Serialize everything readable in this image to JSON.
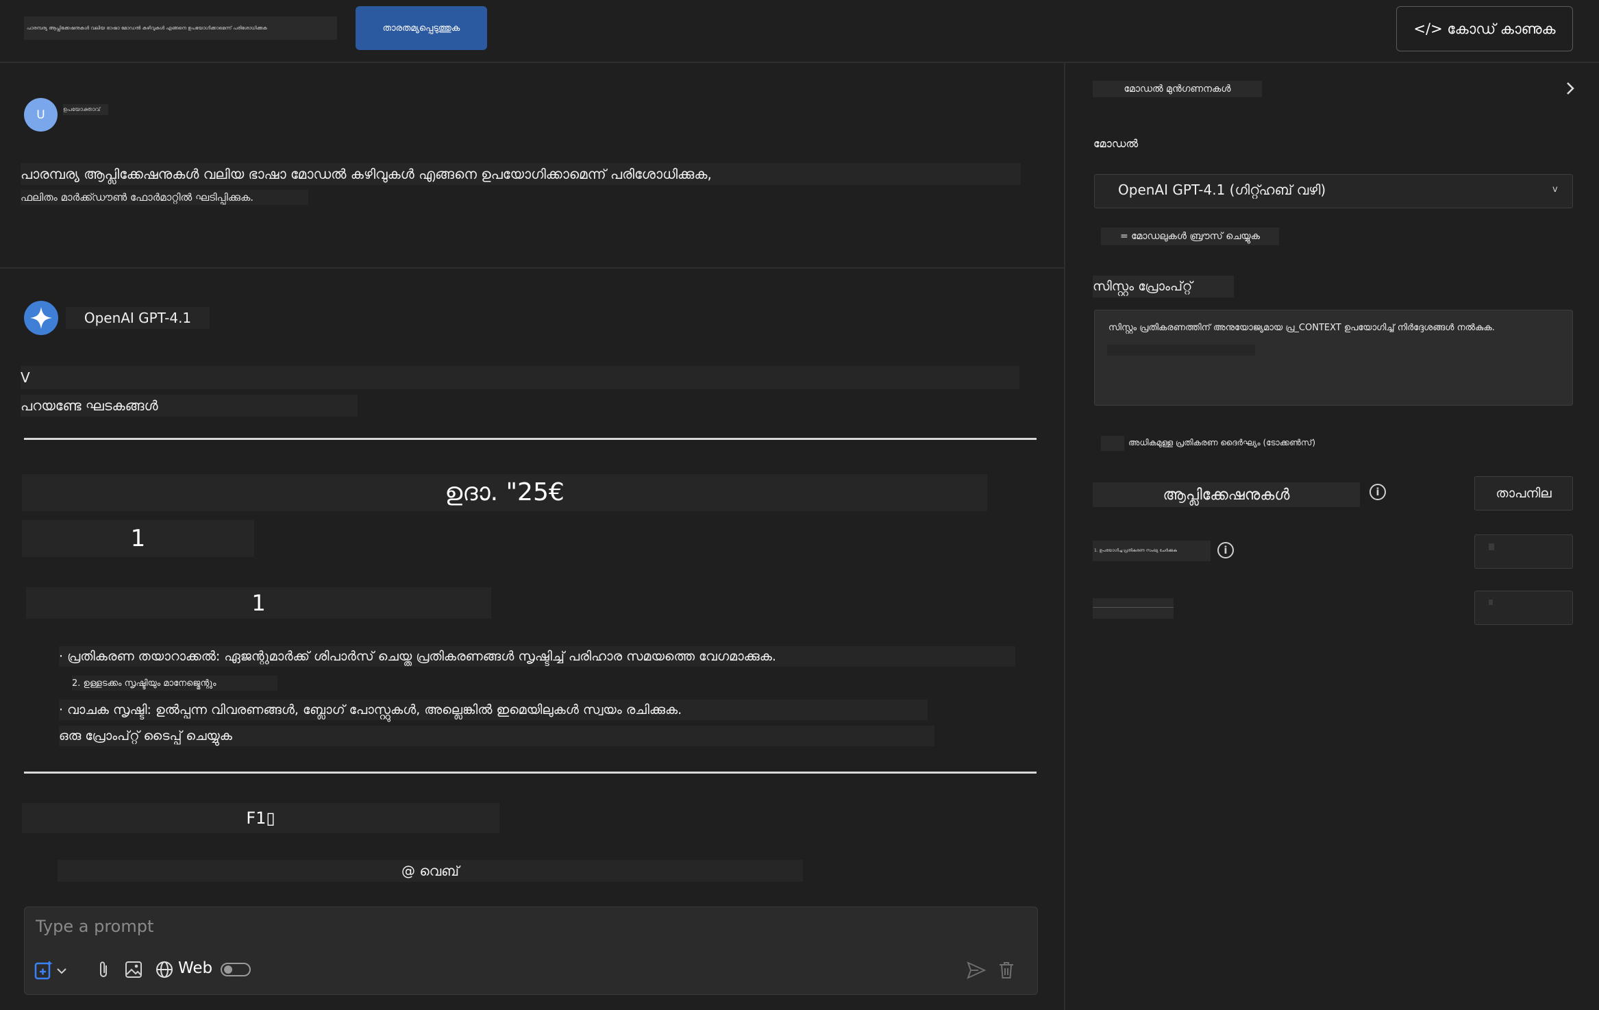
{
  "header": {
    "prompt_text": "പാരമ്പര്യ ആപ്ലിക്കേഷനുകൾ വലിയ ഭാഷാ മോഡൽ കഴിവുകൾ എങ്ങനെ ഉപയോഗിക്കാമെന്ന് പരിശോധിക്കുക",
    "compare_button": "താരതമ്യപ്പെടുത്തുക",
    "view_code_button": "</> കോഡ് കാണുക"
  },
  "user_message": {
    "avatar_letter": "U",
    "role": "ഉപയോക്താവ്",
    "line1": "പാരമ്പര്യ ആപ്ലിക്കേഷനുകൾ വലിയ ഭാഷാ മോഡൽ കഴിവുകൾ എങ്ങനെ ഉപയോഗിക്കാമെന്ന് പരിശോധിക്കുക,",
    "line2": "ഫലിതം മാർക്ക്ഡൗൺ ഫോർമാറ്റിൽ ഘടിപ്പിക്കുക."
  },
  "assistant_message": {
    "model_name": "OpenAI GPT-4.1",
    "v_line": "V",
    "subheading": "പറയണ്ടേ ഘടകങ്ങൾ",
    "example": "ഉദാ. \"25€",
    "num_a": "1",
    "num_b": "1",
    "bullet1": "· പ്രതികരണ തയാറാക്കൽ: ഏജന്റുമാർക്ക് ശിപാർസ് ചെയ്ത പ്രതികരണങ്ങൾ സൃഷ്ടിച്ച് പരിഹാര സമയത്തെ വേഗമാക്കുക.",
    "bullet2": "2. ഉള്ളടക്കം സൃഷ്ടിയും മാനേജ്മെന്റും",
    "bullet3": "· വാചക സൃഷ്ടി: ഉൽപ്പന്ന വിവരണങ്ങൾ, ബ്ലോഗ് പോസ്റ്റുകൾ, അല്ലെങ്കിൽ ഇമെയിലുകൾ സ്വയം രചിക്കുക.",
    "bullet4": "ഒരു പ്രോംപ്റ്റ് ടൈപ്പ് ചെയ്യുക",
    "f1": "F1▯",
    "web_line": "@ വെബ്"
  },
  "composer": {
    "placeholder": "Type a prompt",
    "web_label": "Web",
    "web_toggle_on": false
  },
  "settings": {
    "section_title": "മോഡൽ മുൻഗണനകൾ",
    "model_label": "മോഡൽ",
    "model_value": "OpenAI GPT-4.1 (ഗിറ്റ്ഹബ് വഴി)",
    "model_caret": "v",
    "browse_models": "= മോഡലുകൾ ബ്രൗസ് ചെയ്യുക",
    "system_prompt_label": "സിസ്റ്റം പ്രോംപ്റ്റ്",
    "system_prompt_value": "സിസ്റ്റം പ്രതികരണത്തിന് അനുയോജ്യമായ പ്ര_CONTEXT ഉപയോഗിച്ച് നിർദ്ദേശങ്ങൾ നൽകുക.",
    "max_tokens_label": "അധികമുള്ള പ്രതികരണ ദൈർഘ്യം (ടോക്കൺസ്)",
    "applications_label": "ആപ്ലിക്കേഷനുകൾ",
    "temperature_button": "താപനില",
    "row1_label": "1. ഉപയോഗിച്ച പ്രതികരണ സംഖ്യ ചേർക്കുക",
    "info_glyph": "i",
    "chevron": "›"
  },
  "colors": {
    "background": "#1f1f1f",
    "accent": "#2c5aa0",
    "avatar": "#7aa7ec"
  }
}
